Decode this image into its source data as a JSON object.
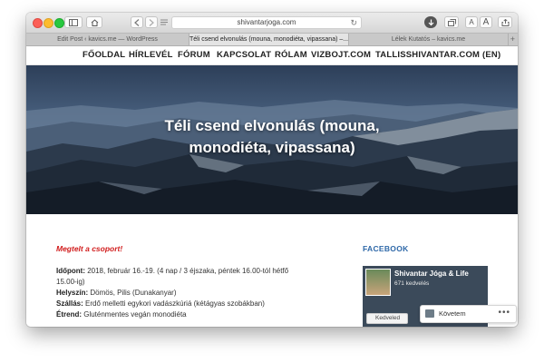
{
  "browser": {
    "url": "shivantarjoga.com",
    "tabs": [
      {
        "label": "Edit Post ‹ kavics.me — WordPress",
        "active": false
      },
      {
        "label": "Téli csend elvonulás (mouna, monodiéta, vipassana) –...",
        "active": true
      },
      {
        "label": "Lélek Kutatós – kavics.me",
        "active": false
      }
    ],
    "icons": {
      "back": "chevron-left-icon",
      "forward": "chevron-right-icon",
      "reader": "reader-icon",
      "reload": "reload-icon",
      "font_small": "A",
      "font_large": "A"
    }
  },
  "nav": {
    "items": [
      "FŐOLDAL",
      "HÍRLEVÉL",
      "FÓRUM",
      "KAPCSOLAT",
      "RÓLAM",
      "VIZBOJT.COM",
      "TALLISSHIVANTAR.COM (EN)"
    ]
  },
  "hero": {
    "title_line1": "Téli csend elvonulás (mouna,",
    "title_line2": "monodiéta, vipassana)"
  },
  "content": {
    "notice": "Megtelt a csoport!",
    "details": [
      {
        "label": "Időpont:",
        "value": " 2018, február 16.-19. (4 nap / 3 éjszaka, péntek 16.00-tól hétfő"
      },
      {
        "label": "",
        "value": "15.00-ig)"
      },
      {
        "label": "Helyszín:",
        "value": " Dömös, Pilis (Dunakanyar)"
      },
      {
        "label": "Szállás:",
        "value": " Erdő melletti egykori vadászkúriá (kétágyas szobákban)"
      },
      {
        "label": "Étrend:",
        "value": " Gluténmentes vegán monodiéta"
      }
    ]
  },
  "sidebar": {
    "widget_title": "FACEBOOK",
    "fb_page_name": "Shivantar Jóga & Life",
    "fb_likes": "671 kedvelés",
    "fb_like_button": "Kedveled"
  },
  "follow": {
    "label": "Követem",
    "more": "•••"
  }
}
